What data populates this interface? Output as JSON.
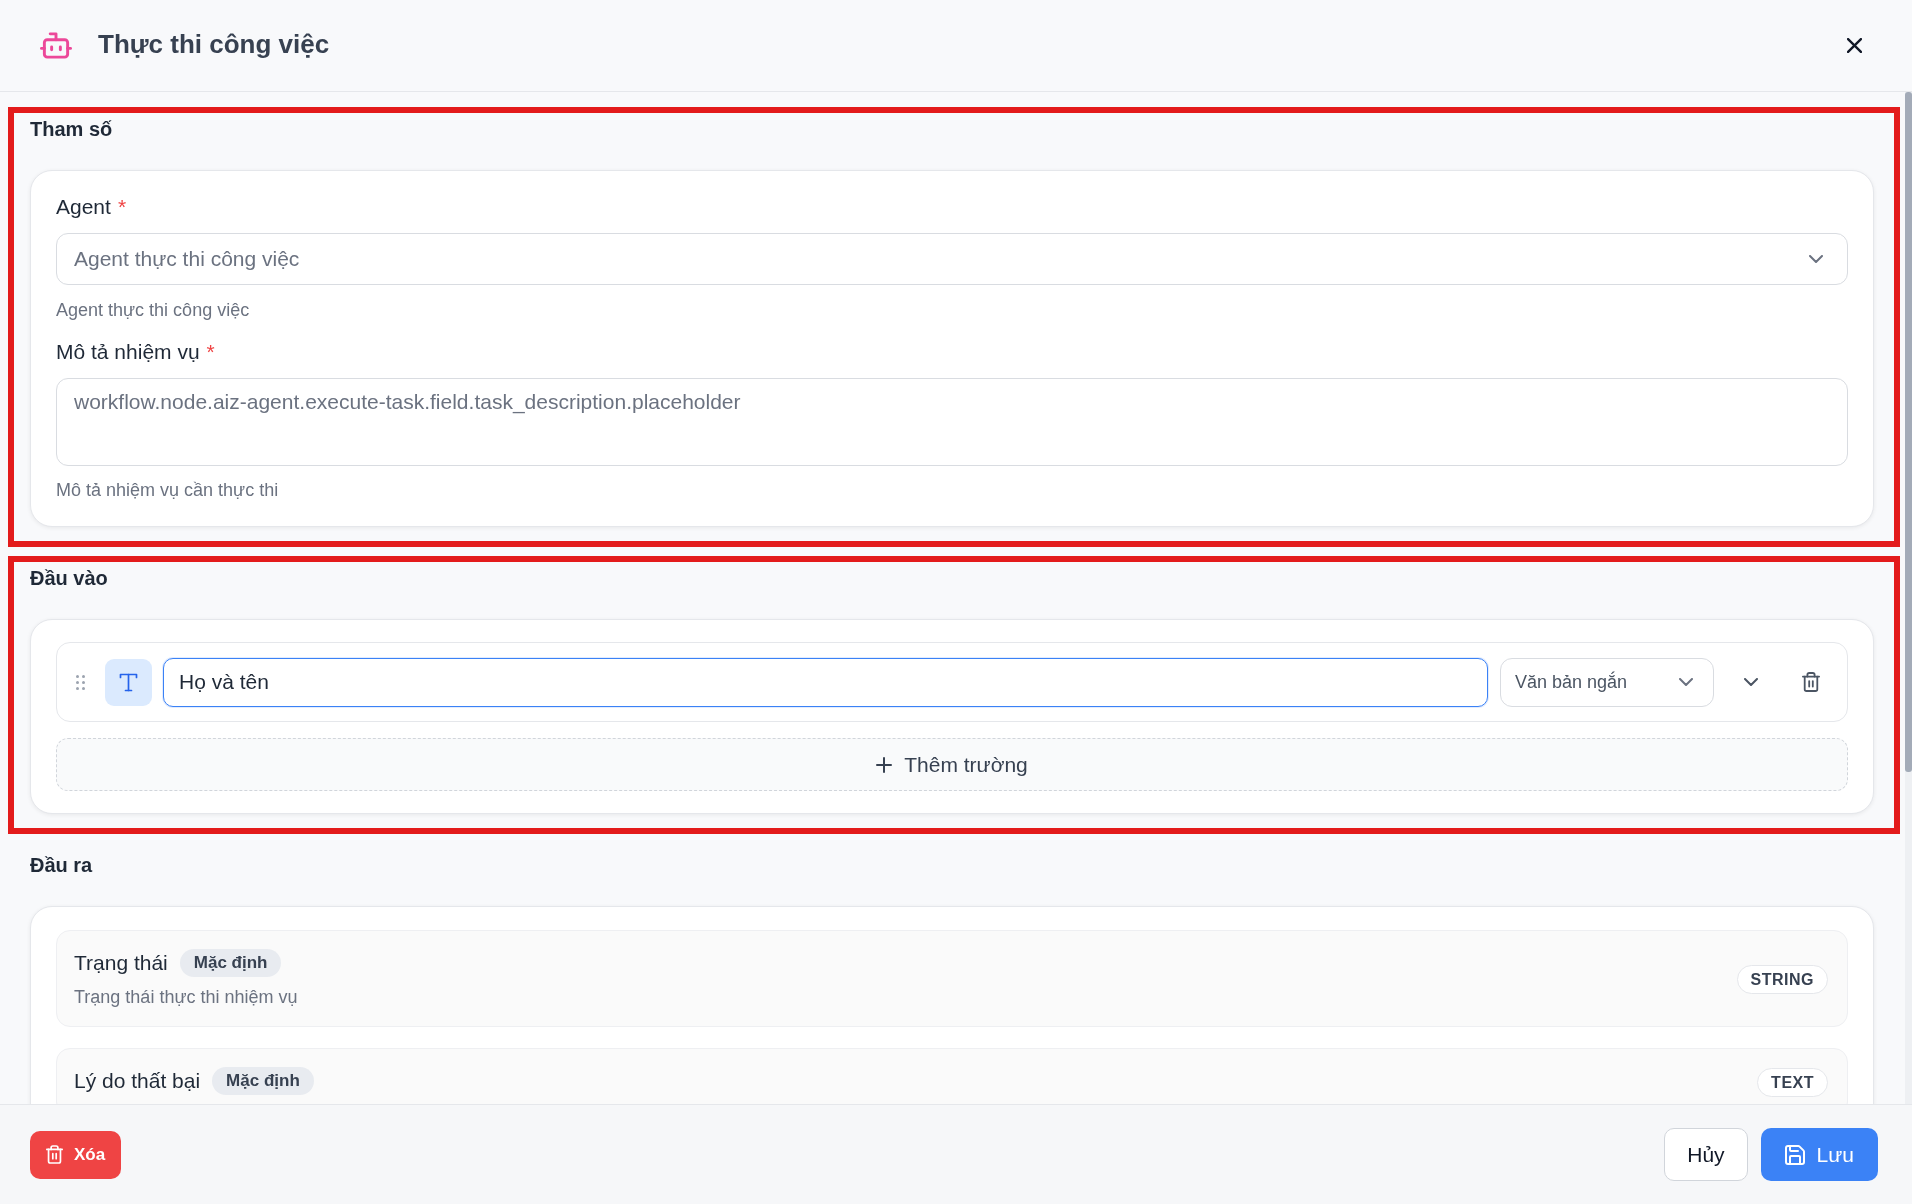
{
  "dialog": {
    "title": "Thực thi công việc"
  },
  "sections": [
    {
      "kind": "params",
      "title": "Tham số",
      "highlighted": true,
      "fields": [
        {
          "kind": "select",
          "label": "Agent",
          "required_mark": "*",
          "placeholder": "Agent thực thi công việc",
          "help": "Agent thực thi công việc"
        },
        {
          "kind": "textarea",
          "label": "Mô tả nhiệm vụ",
          "required_mark": "*",
          "placeholder": "workflow.node.aiz-agent.execute-task.field.task_description.placeholder",
          "help": "Mô tả nhiệm vụ cần thực thi"
        }
      ]
    },
    {
      "kind": "inputs",
      "title": "Đầu vào",
      "highlighted": true,
      "fields": [
        {
          "value": "Họ và tên",
          "focused": true,
          "type": "Văn bản ngắn"
        }
      ],
      "add_button": "Thêm trường"
    },
    {
      "kind": "outputs",
      "title": "Đầu ra",
      "items": [
        {
          "name": "Trạng thái",
          "badge": "Mặc định",
          "description": "Trạng thái thực thi nhiệm vụ",
          "type": "STRING"
        },
        {
          "name": "Lý do thất bại",
          "badge": "Mặc định",
          "type": "TEXT"
        }
      ]
    }
  ],
  "footer": {
    "delete_button": "Xóa",
    "cancel_button": "Hủy",
    "save_button": "Lưu"
  }
}
